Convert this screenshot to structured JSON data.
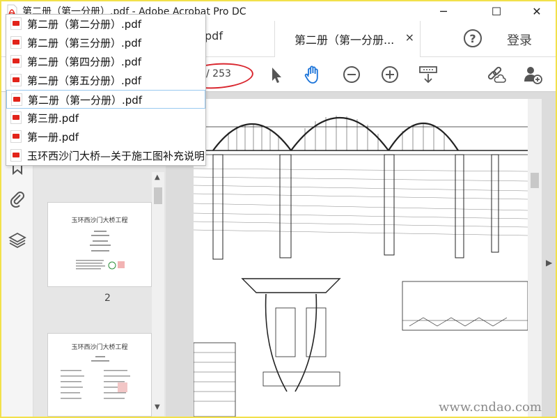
{
  "window": {
    "title": "第二册（第一分册）.pdf - Adobe Acrobat Pro DC",
    "minimize": "─",
    "maximize": "☐",
    "close": "✕"
  },
  "tabs": {
    "prev_tab_partial": "pdf",
    "active_tab_label": "第二册（第一分册...",
    "active_tab_close": "×",
    "help": "?",
    "login": "登录"
  },
  "toolbar": {
    "page_total": "/ 253",
    "tools": [
      "select-arrow-icon",
      "hand-icon",
      "zoom-out-icon",
      "zoom-in-icon",
      "scroll-mode-icon",
      "share-link-icon",
      "add-user-icon"
    ]
  },
  "recent_files": [
    {
      "label": "第二册（第二分册）.pdf"
    },
    {
      "label": "第二册（第三分册）.pdf"
    },
    {
      "label": "第二册（第四分册）.pdf"
    },
    {
      "label": "第二册（第五分册）.pdf"
    },
    {
      "label": "第二册（第一分册）.pdf",
      "selected": true
    },
    {
      "label": "第三册.pdf"
    },
    {
      "label": "第一册.pdf"
    },
    {
      "label": "玉环西沙门大桥—关于施工图补充说明"
    }
  ],
  "thumbnails": {
    "page1_title": "玉环西沙门大桥工程",
    "page2_title": "玉环西沙门大桥工程",
    "page_number": "2"
  },
  "watermark": "www.cndao.com",
  "colors": {
    "frame_border": "#f2e14a",
    "annotation_red": "#d9262e",
    "hand_tool_blue": "#1a73d9",
    "pdf_red": "#e2231a"
  }
}
